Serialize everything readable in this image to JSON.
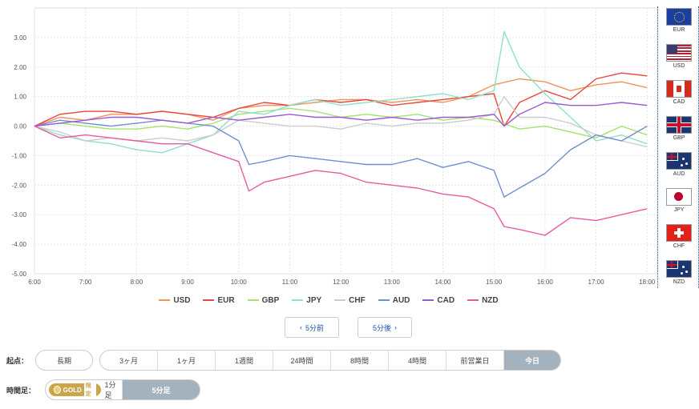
{
  "chart_data": {
    "type": "line",
    "x_labels": [
      "6:00",
      "7:00",
      "8:00",
      "9:00",
      "10:00",
      "11:00",
      "12:00",
      "13:00",
      "14:00",
      "15:00",
      "16:00",
      "17:00",
      "18:00"
    ],
    "x_range": [
      6.0,
      18.2
    ],
    "y_ticks": [
      "3.00",
      "2.00",
      "1.00",
      "0.00",
      "-1.00",
      "-2.00",
      "-3.00",
      "-4.00",
      "-5.00"
    ],
    "ylim": [
      -5,
      4
    ],
    "grid": true,
    "legend_position": "bottom",
    "series": [
      {
        "name": "USD",
        "color": "#f0935a",
        "points": [
          [
            6,
            0
          ],
          [
            6.5,
            0.3
          ],
          [
            7,
            0.2
          ],
          [
            7.5,
            0.4
          ],
          [
            8,
            0.4
          ],
          [
            8.5,
            0.5
          ],
          [
            9,
            0.4
          ],
          [
            9.5,
            0.2
          ],
          [
            10,
            0.6
          ],
          [
            10.5,
            0.7
          ],
          [
            11,
            0.7
          ],
          [
            11.5,
            0.8
          ],
          [
            12,
            0.9
          ],
          [
            12.5,
            0.9
          ],
          [
            13,
            0.8
          ],
          [
            13.5,
            0.9
          ],
          [
            14,
            0.8
          ],
          [
            14.5,
            1.0
          ],
          [
            15,
            1.4
          ],
          [
            15.5,
            1.6
          ],
          [
            16,
            1.5
          ],
          [
            16.5,
            1.2
          ],
          [
            17,
            1.4
          ],
          [
            17.5,
            1.5
          ],
          [
            18,
            1.3
          ]
        ]
      },
      {
        "name": "EUR",
        "color": "#e8453c",
        "points": [
          [
            6,
            0
          ],
          [
            6.5,
            0.4
          ],
          [
            7,
            0.5
          ],
          [
            7.5,
            0.5
          ],
          [
            8,
            0.4
          ],
          [
            8.5,
            0.5
          ],
          [
            9,
            0.4
          ],
          [
            9.5,
            0.3
          ],
          [
            10,
            0.6
          ],
          [
            10.5,
            0.8
          ],
          [
            11,
            0.7
          ],
          [
            11.5,
            0.9
          ],
          [
            12,
            0.8
          ],
          [
            12.5,
            0.9
          ],
          [
            13,
            0.7
          ],
          [
            13.5,
            0.8
          ],
          [
            14,
            0.9
          ],
          [
            14.5,
            1.0
          ],
          [
            15,
            1.1
          ],
          [
            15.2,
            0
          ],
          [
            15.5,
            0.8
          ],
          [
            16,
            1.2
          ],
          [
            16.5,
            0.9
          ],
          [
            17,
            1.6
          ],
          [
            17.5,
            1.8
          ],
          [
            18,
            1.7
          ]
        ]
      },
      {
        "name": "GBP",
        "color": "#a8e070",
        "points": [
          [
            6,
            0
          ],
          [
            6.5,
            0.1
          ],
          [
            7,
            0
          ],
          [
            7.5,
            -0.1
          ],
          [
            8,
            -0.1
          ],
          [
            8.5,
            0
          ],
          [
            9,
            -0.1
          ],
          [
            9.5,
            0.1
          ],
          [
            10,
            0.4
          ],
          [
            10.5,
            0.5
          ],
          [
            11,
            0.6
          ],
          [
            11.5,
            0.5
          ],
          [
            12,
            0.3
          ],
          [
            12.5,
            0.4
          ],
          [
            13,
            0.3
          ],
          [
            13.5,
            0.4
          ],
          [
            14,
            0.2
          ],
          [
            14.5,
            0.3
          ],
          [
            15,
            0.2
          ],
          [
            15.5,
            -0.1
          ],
          [
            16,
            0
          ],
          [
            16.5,
            -0.2
          ],
          [
            17,
            -0.4
          ],
          [
            17.5,
            0
          ],
          [
            18,
            -0.3
          ]
        ]
      },
      {
        "name": "JPY",
        "color": "#8fe0c8",
        "points": [
          [
            6,
            0
          ],
          [
            6.5,
            -0.3
          ],
          [
            7,
            -0.5
          ],
          [
            7.5,
            -0.6
          ],
          [
            8,
            -0.8
          ],
          [
            8.5,
            -0.9
          ],
          [
            9,
            -0.6
          ],
          [
            9.5,
            -0.3
          ],
          [
            10,
            0.5
          ],
          [
            10.5,
            0.4
          ],
          [
            11,
            0.7
          ],
          [
            11.5,
            0.9
          ],
          [
            12,
            0.7
          ],
          [
            12.5,
            0.8
          ],
          [
            13,
            0.9
          ],
          [
            13.5,
            1.0
          ],
          [
            14,
            1.1
          ],
          [
            14.5,
            0.9
          ],
          [
            15,
            1.2
          ],
          [
            15.2,
            3.2
          ],
          [
            15.5,
            2.0
          ],
          [
            16,
            1.1
          ],
          [
            16.5,
            0.3
          ],
          [
            17,
            -0.5
          ],
          [
            17.5,
            -0.3
          ],
          [
            18,
            -0.6
          ]
        ]
      },
      {
        "name": "CHF",
        "color": "#cccccc",
        "points": [
          [
            6,
            0
          ],
          [
            6.5,
            -0.2
          ],
          [
            7,
            -0.5
          ],
          [
            7.5,
            -0.4
          ],
          [
            8,
            -0.5
          ],
          [
            8.5,
            -0.4
          ],
          [
            9,
            -0.5
          ],
          [
            9.5,
            -0.3
          ],
          [
            10,
            0.2
          ],
          [
            10.5,
            0.1
          ],
          [
            11,
            0
          ],
          [
            11.5,
            0
          ],
          [
            12,
            -0.1
          ],
          [
            12.5,
            0.1
          ],
          [
            13,
            0
          ],
          [
            13.5,
            0.1
          ],
          [
            14,
            0.1
          ],
          [
            14.5,
            0.2
          ],
          [
            15,
            0.4
          ],
          [
            15.2,
            1.0
          ],
          [
            15.5,
            0.3
          ],
          [
            16,
            0.3
          ],
          [
            16.5,
            0.1
          ],
          [
            17,
            -0.3
          ],
          [
            17.5,
            -0.5
          ],
          [
            18,
            -0.7
          ]
        ]
      },
      {
        "name": "AUD",
        "color": "#6f8fd0",
        "points": [
          [
            6,
            0
          ],
          [
            6.5,
            0.2
          ],
          [
            7,
            0.1
          ],
          [
            7.5,
            0
          ],
          [
            8,
            0.1
          ],
          [
            8.5,
            0.2
          ],
          [
            9,
            0.1
          ],
          [
            9.5,
            0
          ],
          [
            10,
            -0.5
          ],
          [
            10.2,
            -1.3
          ],
          [
            10.5,
            -1.2
          ],
          [
            11,
            -1.0
          ],
          [
            11.5,
            -1.1
          ],
          [
            12,
            -1.2
          ],
          [
            12.5,
            -1.3
          ],
          [
            13,
            -1.3
          ],
          [
            13.5,
            -1.1
          ],
          [
            14,
            -1.4
          ],
          [
            14.5,
            -1.2
          ],
          [
            15,
            -1.5
          ],
          [
            15.2,
            -2.4
          ],
          [
            15.5,
            -2.1
          ],
          [
            16,
            -1.6
          ],
          [
            16.5,
            -0.8
          ],
          [
            17,
            -0.3
          ],
          [
            17.5,
            -0.5
          ],
          [
            18,
            0
          ]
        ]
      },
      {
        "name": "CAD",
        "color": "#9b59d0",
        "points": [
          [
            6,
            0
          ],
          [
            6.5,
            0.1
          ],
          [
            7,
            0.2
          ],
          [
            7.5,
            0.3
          ],
          [
            8,
            0.3
          ],
          [
            8.5,
            0.2
          ],
          [
            9,
            0.1
          ],
          [
            9.5,
            0.3
          ],
          [
            10,
            0.2
          ],
          [
            10.5,
            0.3
          ],
          [
            11,
            0.4
          ],
          [
            11.5,
            0.3
          ],
          [
            12,
            0.3
          ],
          [
            12.5,
            0.2
          ],
          [
            13,
            0.3
          ],
          [
            13.5,
            0.2
          ],
          [
            14,
            0.3
          ],
          [
            14.5,
            0.3
          ],
          [
            15,
            0.4
          ],
          [
            15.2,
            0
          ],
          [
            15.5,
            0.4
          ],
          [
            16,
            0.8
          ],
          [
            16.5,
            0.7
          ],
          [
            17,
            0.7
          ],
          [
            17.5,
            0.8
          ],
          [
            18,
            0.7
          ]
        ]
      },
      {
        "name": "NZD",
        "color": "#e85aa0",
        "points": [
          [
            6,
            0
          ],
          [
            6.5,
            -0.4
          ],
          [
            7,
            -0.3
          ],
          [
            7.5,
            -0.4
          ],
          [
            8,
            -0.5
          ],
          [
            8.5,
            -0.6
          ],
          [
            9,
            -0.6
          ],
          [
            9.5,
            -0.9
          ],
          [
            10,
            -1.2
          ],
          [
            10.2,
            -2.2
          ],
          [
            10.5,
            -1.9
          ],
          [
            11,
            -1.7
          ],
          [
            11.5,
            -1.5
          ],
          [
            12,
            -1.6
          ],
          [
            12.5,
            -1.9
          ],
          [
            13,
            -2.0
          ],
          [
            13.5,
            -2.1
          ],
          [
            14,
            -2.3
          ],
          [
            14.5,
            -2.4
          ],
          [
            15,
            -2.8
          ],
          [
            15.2,
            -3.4
          ],
          [
            15.5,
            -3.5
          ],
          [
            16,
            -3.7
          ],
          [
            16.5,
            -3.1
          ],
          [
            17,
            -3.2
          ],
          [
            17.5,
            -3.0
          ],
          [
            18,
            -2.8
          ]
        ]
      }
    ]
  },
  "flags": [
    {
      "code": "EUR",
      "bg": "#1a3fa0"
    },
    {
      "code": "USD",
      "bg": "#b22234"
    },
    {
      "code": "CAD",
      "bg": "#d52b1e"
    },
    {
      "code": "GBP",
      "bg": "#1a3570"
    },
    {
      "code": "AUD",
      "bg": "#1a3570"
    },
    {
      "code": "JPY",
      "bg": "#ffffff"
    },
    {
      "code": "CHF",
      "bg": "#e32119"
    },
    {
      "code": "NZD",
      "bg": "#1a3570"
    }
  ],
  "nav": {
    "prev": "5分前",
    "next": "5分後"
  },
  "origin": {
    "label": "起点：",
    "long": "長期",
    "options": [
      "3ヶ月",
      "1ヶ月",
      "1週間",
      "24時間",
      "8時間",
      "4時間",
      "前営業日",
      "今日"
    ],
    "active_index": 7
  },
  "timeframe": {
    "label": "時間足：",
    "gold": "GOLD",
    "gold_tag": "限定",
    "options": [
      "1分足",
      "5分足"
    ],
    "active_index": 1
  }
}
